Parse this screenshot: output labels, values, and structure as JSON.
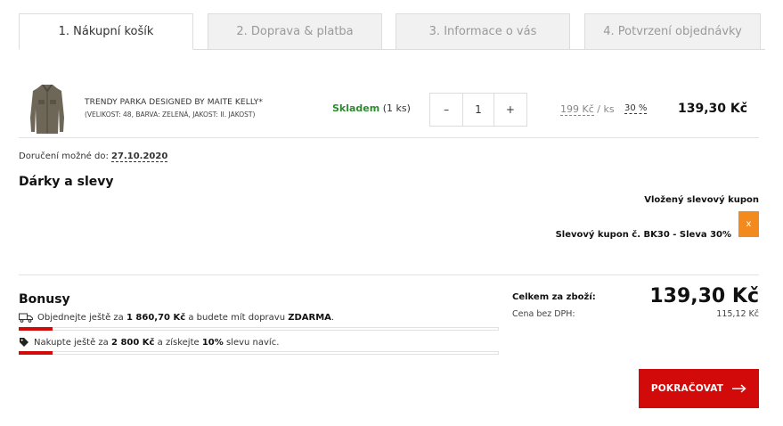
{
  "tabs": [
    {
      "label": "1. Nákupní košík",
      "active": true
    },
    {
      "label": "2. Doprava & platba",
      "active": false
    },
    {
      "label": "3. Informace o vás",
      "active": false
    },
    {
      "label": "4. Potvrzení objednávky",
      "active": false
    }
  ],
  "cart_item": {
    "name": "TRENDY PARKA DESIGNED BY MAITE KELLY*",
    "variant": "(VELIKOST: 48, BARVA: ZELENÁ, JAKOST: II. JAKOST)",
    "stock_status": "Skladem",
    "stock_qty": "(1 ks)",
    "minus_label": "–",
    "quantity": "1",
    "plus_label": "+",
    "unit_price": "199 Kč",
    "unit_suffix": "/ ks",
    "discount": "30 %",
    "total": "139,30 Kč"
  },
  "delivery": {
    "label": "Doručení možné do:",
    "date": "27.10.2020"
  },
  "gifts": {
    "title": "Dárky a slevy",
    "coupon_title": "Vložený slevový kupon",
    "coupon_text": "Slevový kupon č. BK30 - Sleva 30%",
    "remove_label": "x"
  },
  "bonuses": {
    "title": "Bonusy",
    "items": [
      {
        "icon": "truck-icon",
        "pre": "Objednejte ještě za",
        "amount": "1 860,70 Kč",
        "mid": "a budete mít dopravu",
        "highlight": "ZDARMA",
        "post": ".",
        "progress": 0.07
      },
      {
        "icon": "tag-icon",
        "pre": "Nakupte ještě za",
        "amount": "2 800 Kč",
        "mid": "a získejte",
        "highlight": "10%",
        "post": "slevu navíc.",
        "progress": 0.07
      }
    ]
  },
  "summary": {
    "total_label": "Celkem za zboží:",
    "total_value": "139,30 Kč",
    "net_label": "Cena bez DPH:",
    "net_value": "115,12 Kč"
  },
  "actions": {
    "continue_label": "POKRAČOVAT"
  },
  "colors": {
    "accent": "#d20a0a",
    "stock": "#2e8a2e",
    "coupon_remove": "#f28a1e"
  }
}
